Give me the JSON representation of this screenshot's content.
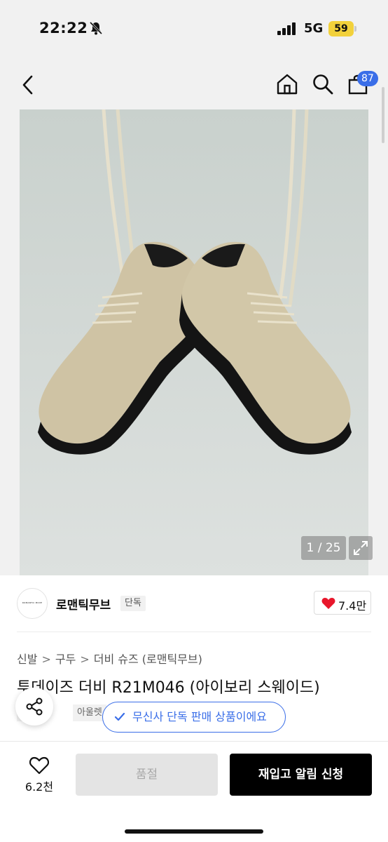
{
  "status_bar": {
    "time": "22:22",
    "network": "5G",
    "battery": "59"
  },
  "nav": {
    "cart_count": "87"
  },
  "image": {
    "counter": "1 / 25",
    "background": "#cfd7d3"
  },
  "brand": {
    "logo_text": "ROMANTIC MOVE",
    "name": "로맨틱무브",
    "tag": "단독",
    "likes": "7.4만"
  },
  "breadcrumb": [
    "신발",
    "구두",
    "더비 슈즈 (로맨틱무브)"
  ],
  "breadcrumb_separator": ">",
  "product": {
    "title": "투데이즈 더비 R21M046 (아이보리 스웨이드)",
    "tags": [
      "단독",
      "아울렛"
    ]
  },
  "exclusive_badge": "무신사 단독 판매 상품이에요",
  "bottom_bar": {
    "wish_count": "6.2천",
    "soldout_label": "품절",
    "restock_label": "재입고 알림 신청"
  },
  "colors": {
    "accent_blue": "#3a6ee8",
    "like_red": "#e8162b",
    "battery_yellow": "#f2d13b"
  }
}
